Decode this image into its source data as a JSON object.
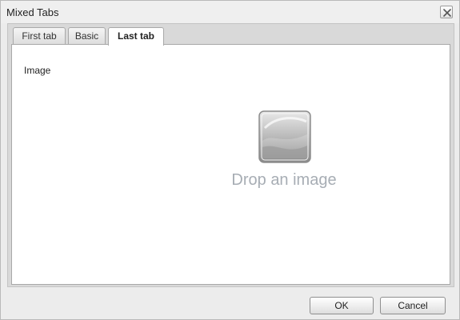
{
  "dialog": {
    "title": "Mixed Tabs",
    "close_icon": "close-icon"
  },
  "tabs": [
    {
      "label": "First tab",
      "active": false
    },
    {
      "label": "Basic",
      "active": false
    },
    {
      "label": "Last tab",
      "active": true
    }
  ],
  "panel": {
    "field_label": "Image",
    "drop_zone": {
      "icon": "image-placeholder-icon",
      "text": "Drop an image"
    }
  },
  "footer": {
    "ok_label": "OK",
    "cancel_label": "Cancel"
  }
}
